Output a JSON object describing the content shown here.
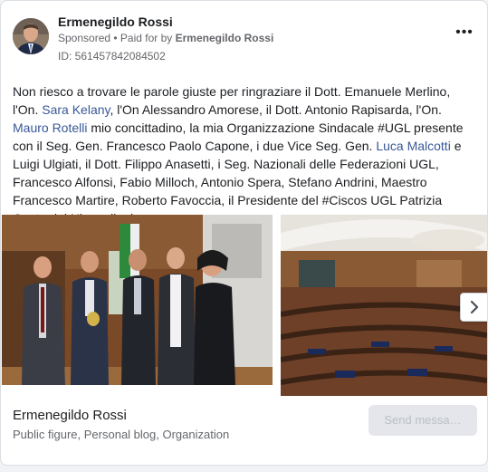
{
  "post": {
    "author": "Ermenegildo Rossi",
    "sponsored_label": "Sponsored",
    "paid_for_prefix": " • Paid for by ",
    "paid_for_name": "Ermenegildo Rossi",
    "ad_id": "ID: 561457842084502",
    "more_label": "•••"
  },
  "text": {
    "p1": "Non riesco a trovare le parole giuste per ringraziare il Dott. Emanuele Merlino, l'On. ",
    "link1": "Sara Kelany",
    "p2": ", l'On Alessandro Amorese, il Dott. Antonio Rapisarda, l'On. ",
    "link2": "Mauro Rotelli",
    "p3": " mio concittadino, la mia Organizzazione Sindacale #UGL presente con il Seg. Gen. Francesco Paolo Capone, i due Vice Seg. Gen. ",
    "link3": "Luca Malcotti",
    "p4": " e Luigi Ulgiati, il Dott. Filippo Anasetti, i Seg. Nazionali delle Federazioni UGL, Francesco Alfonsi, Fabio Milloch, Antonio Spera, Stefano Andrini, Maestro Francesco Martire, Roberto Favoccia, il Presidente del #Ciscos UGL Patrizia Conte del Ninno, il mio…"
  },
  "footer": {
    "name": "Ermenegildo Rossi",
    "categories": "Public figure, Personal blog, Organization",
    "send_button": "Send messa…"
  },
  "icons": {
    "more": "more-options-icon",
    "next": "chevron-right-icon"
  }
}
